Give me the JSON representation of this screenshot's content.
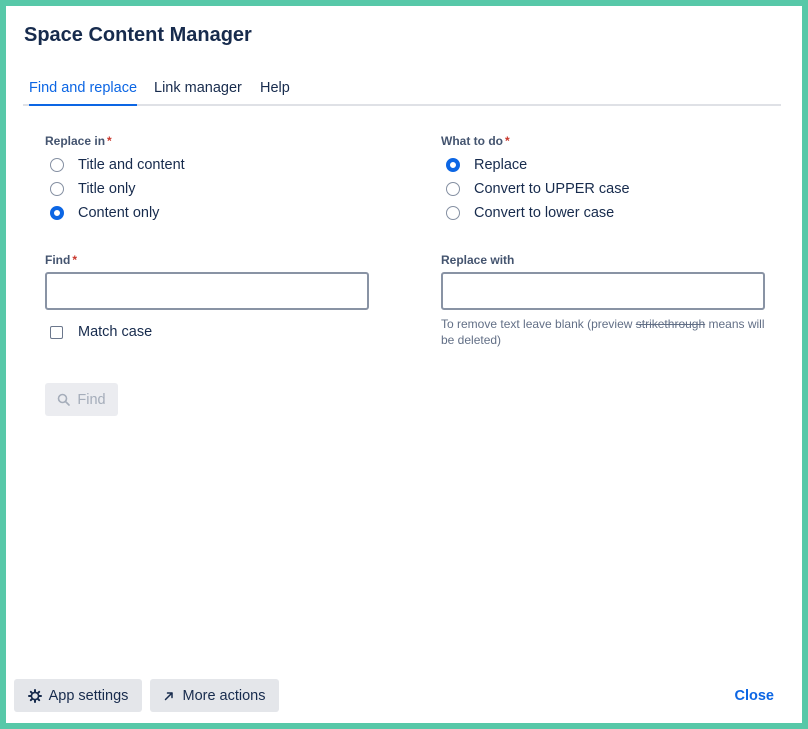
{
  "dialog": {
    "title": "Space Content Manager"
  },
  "tabs": [
    {
      "label": "Find and replace",
      "active": true
    },
    {
      "label": "Link manager",
      "active": false
    },
    {
      "label": "Help",
      "active": false
    }
  ],
  "replace_in": {
    "label": "Replace in",
    "required_mark": "*",
    "options": [
      {
        "label": "Title and content",
        "checked": false
      },
      {
        "label": "Title only",
        "checked": false
      },
      {
        "label": "Content only",
        "checked": true
      }
    ]
  },
  "what_to_do": {
    "label": "What to do",
    "required_mark": "*",
    "options": [
      {
        "label": "Replace",
        "checked": true
      },
      {
        "label": "Convert to UPPER case",
        "checked": false
      },
      {
        "label": "Convert to lower case",
        "checked": false
      }
    ]
  },
  "find": {
    "label": "Find",
    "required_mark": "*",
    "value": "",
    "match_case_label": "Match case",
    "match_case_checked": false
  },
  "replace_with": {
    "label": "Replace with",
    "value": "",
    "hint_before": "To remove text leave blank (preview ",
    "hint_strike": "strikethrough",
    "hint_after": " means will be deleted)"
  },
  "find_button": {
    "label": "Find",
    "icon": "search-icon",
    "enabled": false
  },
  "footer": {
    "app_settings_label": "App settings",
    "app_settings_icon": "gear-icon",
    "more_actions_label": "More actions",
    "more_actions_icon": "arrow-up-right-icon",
    "close_label": "Close"
  },
  "colors": {
    "accent": "#0c66e4",
    "frame": "#57c8a8",
    "required": "#c9372c"
  }
}
